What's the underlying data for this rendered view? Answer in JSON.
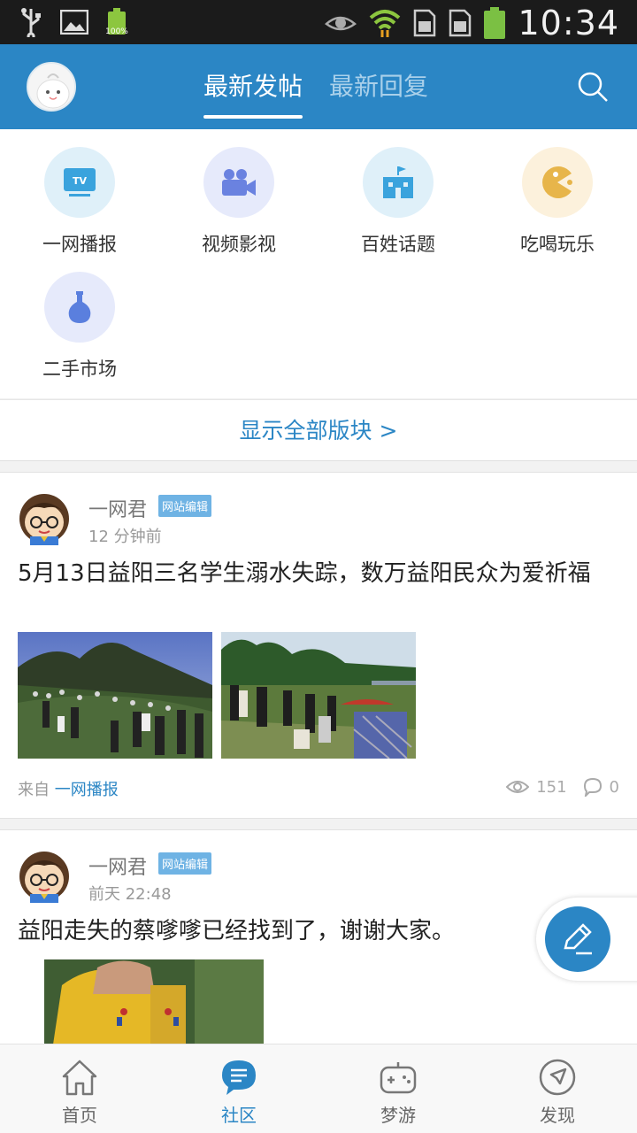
{
  "status_bar": {
    "time": "10:34",
    "battery_small_label": "100%",
    "icons": [
      "usb-icon",
      "image-icon",
      "battery-icon",
      "eye-icon",
      "wifi-icon",
      "sim1-icon",
      "sim2-icon",
      "battery-full-icon"
    ]
  },
  "header": {
    "tabs": [
      {
        "label": "最新发帖",
        "active": true
      },
      {
        "label": "最新回复",
        "active": false
      }
    ],
    "icons": [
      "avatar-icon",
      "search-icon"
    ]
  },
  "categories": [
    {
      "label": "一网播报",
      "icon": "tv-icon",
      "color": "#3aa3dd"
    },
    {
      "label": "视频影视",
      "icon": "video-camera-icon",
      "color": "#6a82e0"
    },
    {
      "label": "百姓话题",
      "icon": "building-icon",
      "color": "#3aa3dd"
    },
    {
      "label": "吃喝玩乐",
      "icon": "pacman-icon",
      "color": "#e7b54a"
    },
    {
      "label": "二手市场",
      "icon": "vase-icon",
      "color": "#5a7fde"
    }
  ],
  "show_all": "显示全部版块 >",
  "posts": [
    {
      "author": "一网君",
      "badge": "网站编辑",
      "time": "12 分钟前",
      "title": "5月13日益阳三名学生溺水失踪，数万益阳民众为爱祈福",
      "source_prefix": "来自",
      "source": "一网播报",
      "views": "151",
      "comments": "0"
    },
    {
      "author": "一网君",
      "badge": "网站编辑",
      "time": "前天 22:48",
      "title": "益阳走失的蔡嗲嗲已经找到了，谢谢大家。"
    }
  ],
  "bottom_nav": [
    {
      "label": "首页",
      "icon": "home-icon",
      "active": false
    },
    {
      "label": "社区",
      "icon": "chat-bubble-icon",
      "active": true
    },
    {
      "label": "梦游",
      "icon": "gamepad-icon",
      "active": false
    },
    {
      "label": "发现",
      "icon": "compass-icon",
      "active": false
    }
  ],
  "colors": {
    "brand": "#2b86c5",
    "status_bar": "#1b1b1b",
    "badge": "#6fb3e4"
  }
}
